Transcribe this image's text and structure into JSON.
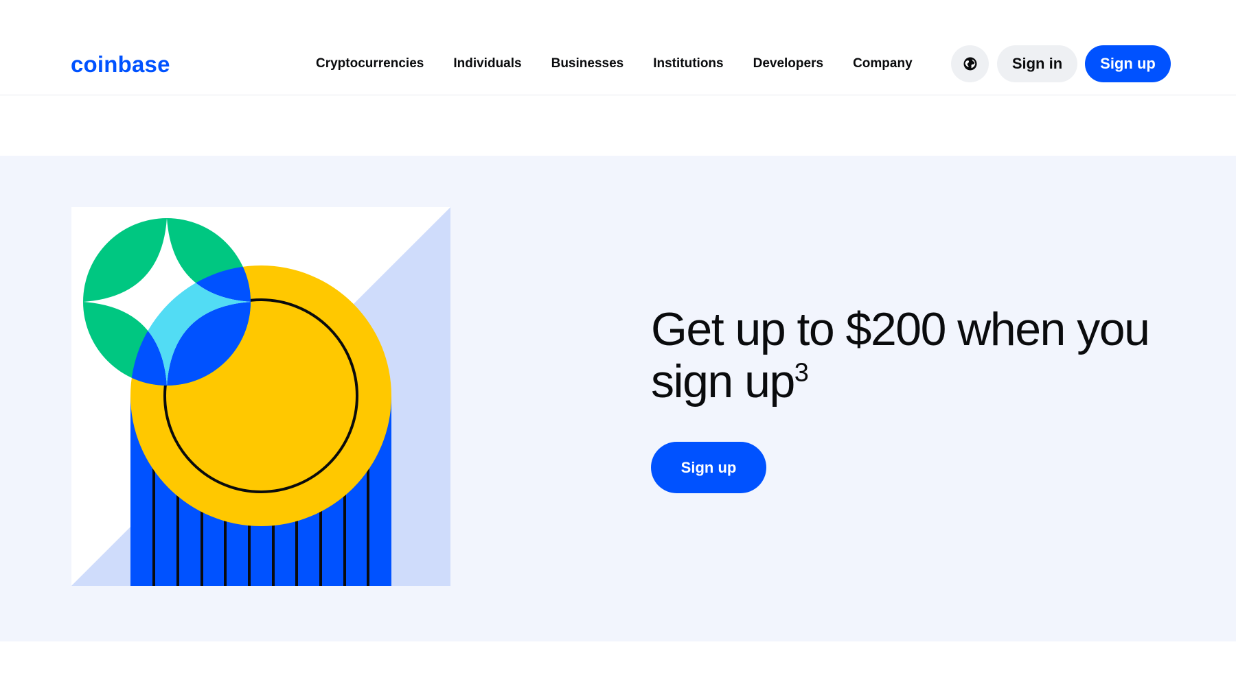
{
  "header": {
    "logo_text": "coinbase",
    "nav_items": [
      "Cryptocurrencies",
      "Individuals",
      "Businesses",
      "Institutions",
      "Developers",
      "Company"
    ],
    "language_icon": "globe-icon",
    "sign_in_label": "Sign in",
    "sign_up_label": "Sign up"
  },
  "hero": {
    "title_main": "Get up to $200 when you sign up",
    "title_superscript": "3",
    "cta_label": "Sign up",
    "illustration": "coin-sparkle-illustration"
  },
  "colors": {
    "brand_blue": "#0052ff",
    "hero_background": "#f2f5fd",
    "coin_yellow": "#ffc800",
    "sparkle_green": "#00c781",
    "light_blue": "#cfdcfb",
    "cyan": "#52dcf4"
  }
}
